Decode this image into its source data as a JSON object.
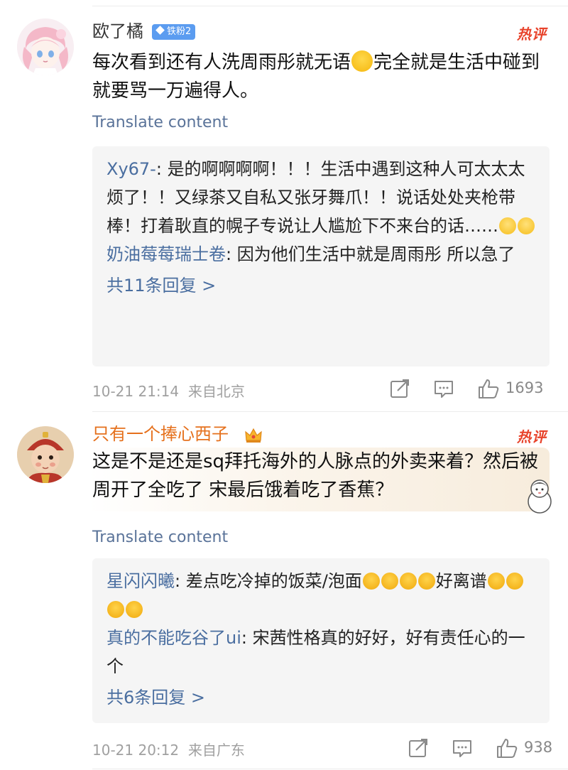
{
  "comments": [
    {
      "username": "欧了橘",
      "badge": "铁粉2",
      "hot_tag": "热评",
      "text_a": "每次看到还有人洗周雨彤就无语",
      "text_b": "完全就是生活中碰到就要骂一万遍得人。",
      "translate": "Translate content",
      "replies": [
        {
          "name": "Xy67-",
          "text": "是的啊啊啊啊！！！生活中遇到这种人可太太太烦了！！又绿茶又自私又张牙舞爪！！说话处处夹枪带棒！打着耿直的幌子专说让人尴尬下不来台的话……"
        },
        {
          "name": "奶油莓莓瑞士卷",
          "text": "因为他们生活中就是周雨彤 所以急了"
        }
      ],
      "more_replies": "共11条回复 >",
      "time": "10-21 21:14",
      "location": "来自北京",
      "likes": "1693"
    },
    {
      "username": "只有一个捧心西子",
      "hot_tag": "热评",
      "text": "这是不是还是sq拜托海外的人脉点的外卖来着？然后被周开了全吃了 宋最后饿着吃了香蕉？",
      "translate": "Translate content",
      "replies": [
        {
          "name": "星闪闪曦",
          "text": "差点吃冷掉的饭菜/泡面",
          "text_b": "好离谱"
        },
        {
          "name": "真的不能吃谷了ui",
          "text": "宋茜性格真的好好，好有责任心的一个"
        }
      ],
      "more_replies": "共6条回复 >",
      "time": "10-21 20:12",
      "location": "来自广东",
      "likes": "938"
    }
  ],
  "icons": [
    "repost-icon",
    "comment-icon",
    "like-icon",
    "diamond-icon",
    "crown-icon",
    "cry-emoji",
    "angry-emoji",
    "smirk-emoji"
  ],
  "colors": {
    "username_vip": "#e5701c",
    "reply_name": "#4a6ea0",
    "hot": "#e8432b",
    "badge": "#5b9cf0"
  }
}
